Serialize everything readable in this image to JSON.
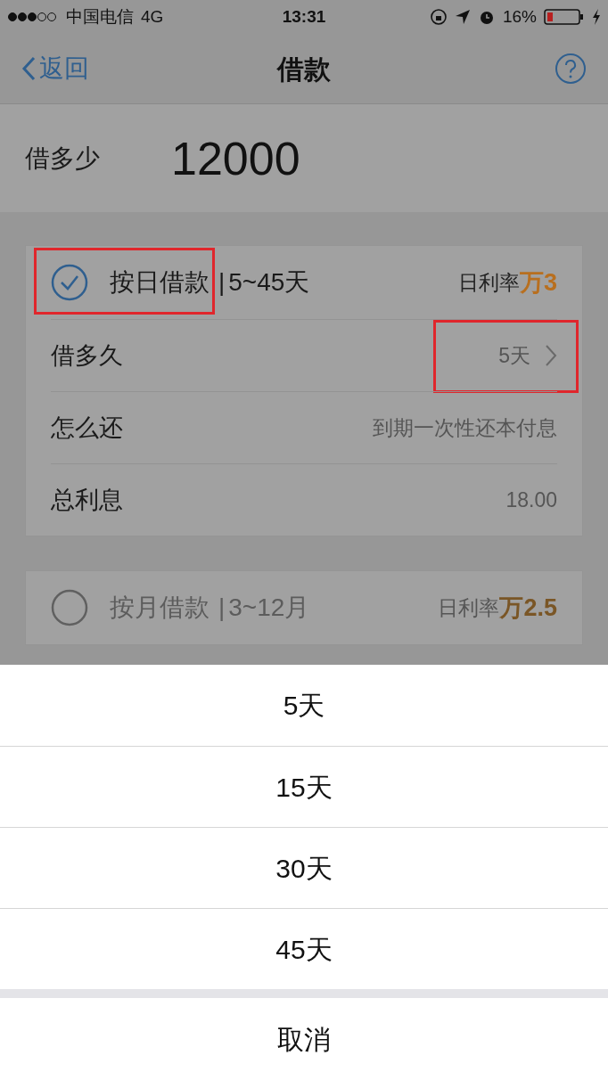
{
  "status_bar": {
    "carrier": "中国电信",
    "network": "4G",
    "time": "13:31",
    "battery": "16%"
  },
  "nav": {
    "back": "返回",
    "title": "借款"
  },
  "amount": {
    "label": "借多少",
    "value": "12000"
  },
  "plans": [
    {
      "title": "按日借款",
      "separator": "|",
      "range": "5~45天",
      "rate_label": "日利率",
      "rate": "万3",
      "selected": true,
      "highlighted": true,
      "rows": [
        {
          "kind": "link",
          "label": "借多久",
          "value": "5天",
          "highlighted": true
        },
        {
          "kind": "text",
          "label": "怎么还",
          "value": "到期一次性还本付息",
          "highlighted": false
        },
        {
          "kind": "text",
          "label": "总利息",
          "value": "18.00",
          "highlighted": false
        }
      ]
    },
    {
      "title": "按月借款",
      "separator": "|",
      "range": "3~12月",
      "rate_label": "日利率",
      "rate": "万2.5",
      "selected": false,
      "highlighted": false
    }
  ],
  "sheet": {
    "options": [
      "5天",
      "15天",
      "30天",
      "45天"
    ],
    "cancel": "取消"
  }
}
